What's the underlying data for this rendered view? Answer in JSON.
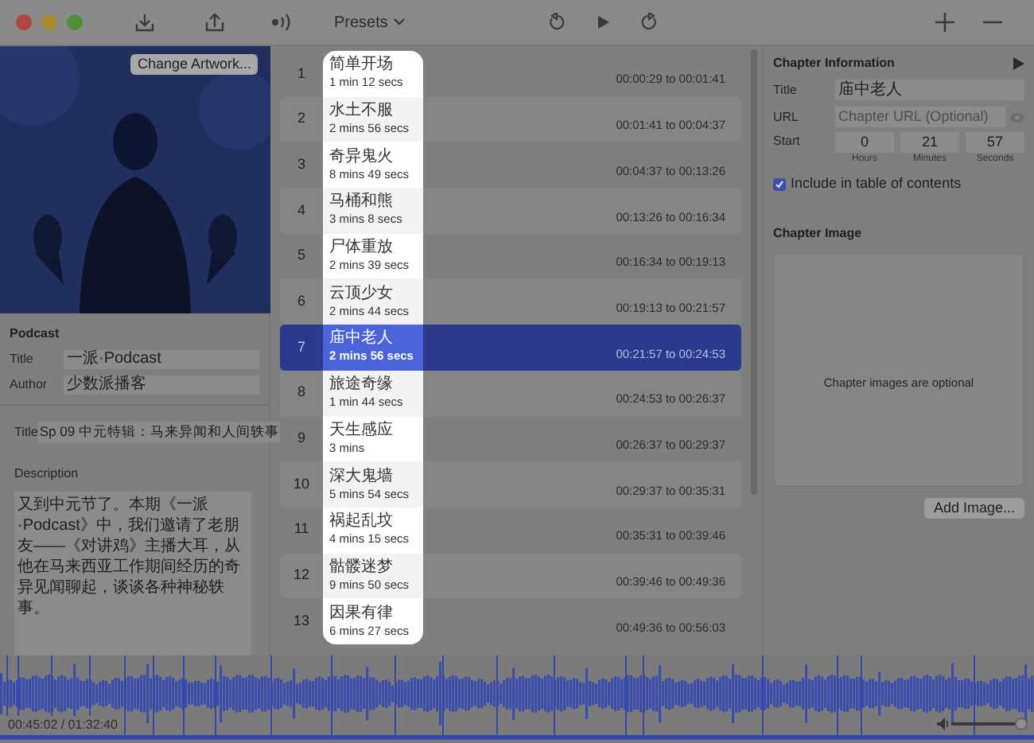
{
  "toolbar": {
    "presets_label": "Presets"
  },
  "artwork": {
    "kind": "picture",
    "change_button": "Change Artwork..."
  },
  "podcast": {
    "heading": "Podcast",
    "fields": [
      {
        "label": "Title",
        "value": "一派·Podcast"
      },
      {
        "label": "Author",
        "value": "少数派播客"
      }
    ]
  },
  "episode": {
    "title_label": "Title",
    "title": "Sp 09 中元特辑：马来异闻和人间轶事",
    "description_label": "Description",
    "description": "又到中元节了。本期《一派·Podcast》中，我们邀请了老朋友——《对讲鸡》主播大耳，从他在马来西亚工作期间经历的奇异见闻聊起，谈谈各种神秘轶事。"
  },
  "chapters": [
    {
      "number": "1",
      "title": "简单开场",
      "duration": "1 min 12 secs",
      "range": "00:00:29 to 00:01:41",
      "selected": false
    },
    {
      "number": "2",
      "title": "水土不服",
      "duration": "2 mins 56 secs",
      "range": "00:01:41 to 00:04:37",
      "selected": false
    },
    {
      "number": "3",
      "title": "奇异鬼火",
      "duration": "8 mins 49 secs",
      "range": "00:04:37 to 00:13:26",
      "selected": false
    },
    {
      "number": "4",
      "title": "马桶和熊",
      "duration": "3 mins 8 secs",
      "range": "00:13:26 to 00:16:34",
      "selected": false
    },
    {
      "number": "5",
      "title": "尸体重放",
      "duration": "2 mins 39 secs",
      "range": "00:16:34 to 00:19:13",
      "selected": false
    },
    {
      "number": "6",
      "title": "云顶少女",
      "duration": "2 mins 44 secs",
      "range": "00:19:13 to 00:21:57",
      "selected": false
    },
    {
      "number": "7",
      "title": "庙中老人",
      "duration": "2 mins 56 secs",
      "range": "00:21:57 to 00:24:53",
      "selected": true
    },
    {
      "number": "8",
      "title": "旅途奇缘",
      "duration": "1 min 44 secs",
      "range": "00:24:53 to 00:26:37",
      "selected": false
    },
    {
      "number": "9",
      "title": "天生感应",
      "duration": "3 mins",
      "range": "00:26:37 to 00:29:37",
      "selected": false
    },
    {
      "number": "10",
      "title": "深大鬼墙",
      "duration": "5 mins 54 secs",
      "range": "00:29:37 to 00:35:31",
      "selected": false
    },
    {
      "number": "11",
      "title": "祸起乱坟",
      "duration": "4 mins 15 secs",
      "range": "00:35:31 to 00:39:46",
      "selected": false
    },
    {
      "number": "12",
      "title": "骷髅迷梦",
      "duration": "9 mins 50 secs",
      "range": "00:39:46 to 00:49:36",
      "selected": false
    },
    {
      "number": "13",
      "title": "因果有律",
      "duration": "6 mins 27 secs",
      "range": "00:49:36 to 00:56:03",
      "selected": false
    }
  ],
  "chapter_info": {
    "heading": "Chapter Information",
    "title_label": "Title",
    "title": "庙中老人",
    "url_label": "URL",
    "url_placeholder": "Chapter URL (Optional)",
    "start_label": "Start",
    "start": [
      {
        "value": "0",
        "unit": "Hours"
      },
      {
        "value": "21",
        "unit": "Minutes"
      },
      {
        "value": "57",
        "unit": "Seconds"
      }
    ],
    "include_toc": {
      "label": "Include in table of contents",
      "checked": true
    },
    "image_heading": "Chapter Image",
    "image_hint": "Chapter images are optional",
    "add_button": "Add Image..."
  },
  "player": {
    "position": "00:45:02 / 01:32:40",
    "volume": {
      "level": 0.95
    }
  }
}
